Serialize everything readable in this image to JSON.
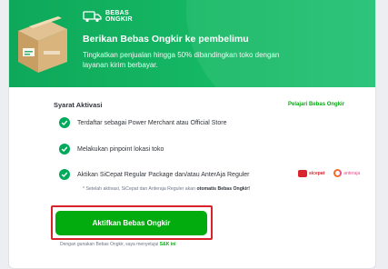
{
  "banner": {
    "brand_line1": "BEBAS",
    "brand_line2": "ONGKIR",
    "title": "Berikan Bebas Ongkir ke pembelimu",
    "description": "Tingkatkan penjualan hingga 50% dibandingkan toko dengan layanan kirim berbayar.",
    "icons": [
      "box-illustration",
      "truck-icon"
    ]
  },
  "requirements": {
    "title": "Syarat Aktivasi",
    "learn_more": "Pelajari Bebas Ongkir",
    "items": [
      "Terdaftar sebagai Power Merchant atau Official Store",
      "Melakukan pinpoint lokasi toko",
      "Aktikan SiCepat Regular Package dan/atau AnterAja Reguler"
    ],
    "logos": [
      "sicepat",
      "anteraja"
    ],
    "note_prefix": "* Setelah aktivasi, SiCepat dan Anteraja Reguler akan ",
    "note_emphasis": "otomatis Bebas Ongkir!"
  },
  "cta": {
    "label": "Aktifkan Bebas Ongkir",
    "terms_prefix": "Dengan gunakan Bebas Ongkir, saya menyetujui ",
    "terms_link": "S&K ini"
  },
  "colors": {
    "accent": "#03ac0e",
    "banner": "#15b864",
    "highlight_outline": "#d8232a"
  }
}
